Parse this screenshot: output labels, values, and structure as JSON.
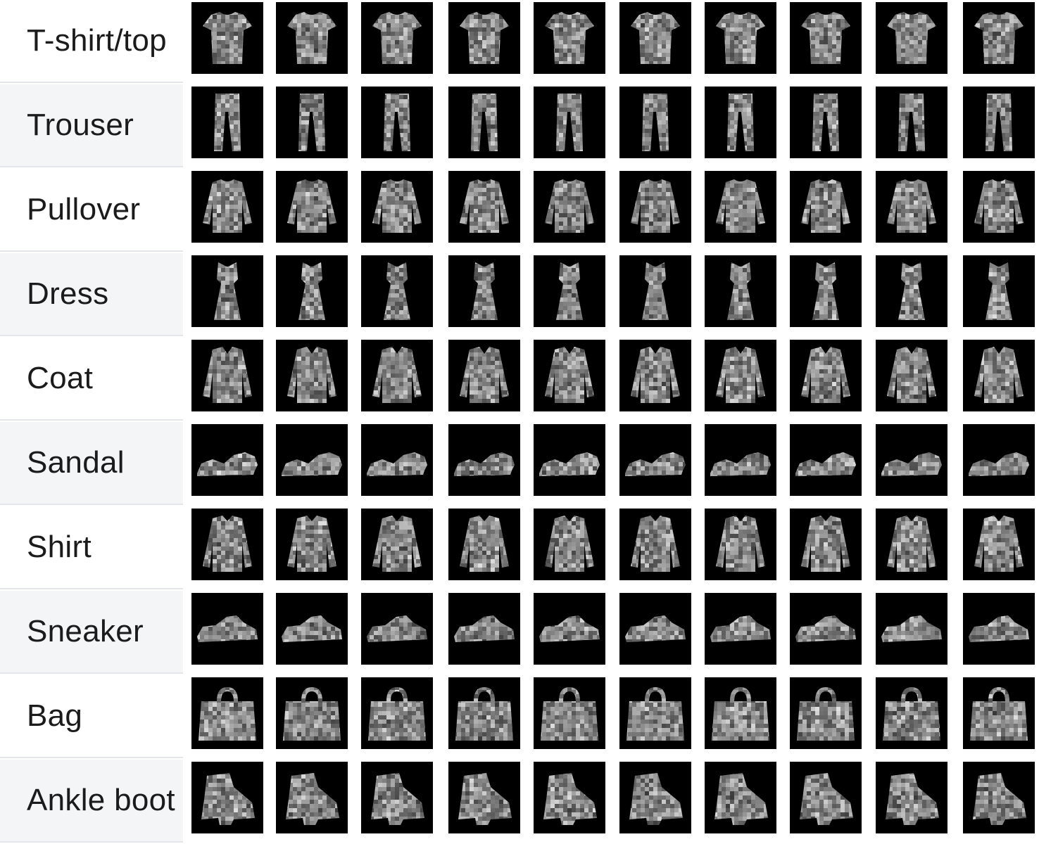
{
  "rows": [
    {
      "label": "T-shirt/top",
      "kind": "tshirt"
    },
    {
      "label": "Trouser",
      "kind": "trouser"
    },
    {
      "label": "Pullover",
      "kind": "pullover"
    },
    {
      "label": "Dress",
      "kind": "dress"
    },
    {
      "label": "Coat",
      "kind": "coat"
    },
    {
      "label": "Sandal",
      "kind": "sandal"
    },
    {
      "label": "Shirt",
      "kind": "shirt"
    },
    {
      "label": "Sneaker",
      "kind": "sneaker"
    },
    {
      "label": "Bag",
      "kind": "bag"
    },
    {
      "label": "Ankle boot",
      "kind": "boot"
    }
  ],
  "samples_per_row": 10,
  "colors": {
    "image_background": "#000000",
    "row_alt_background": "#f4f5f7",
    "divider": "#e3e6ea"
  }
}
